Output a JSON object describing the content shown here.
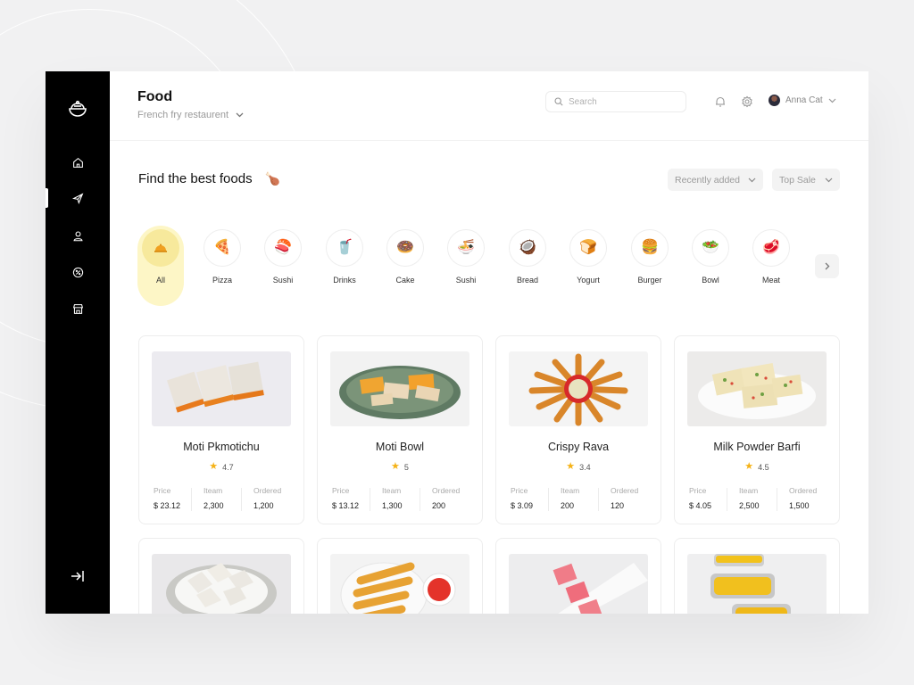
{
  "header": {
    "title": "Food",
    "subtitle": "French fry restaurent",
    "search_placeholder": "Search",
    "user_name": "Anna Cat"
  },
  "sidebar": {
    "items": [
      {
        "icon": "home-icon"
      },
      {
        "icon": "send-icon",
        "active": true
      },
      {
        "icon": "user-icon"
      },
      {
        "icon": "discount-icon"
      },
      {
        "icon": "store-icon"
      }
    ]
  },
  "section": {
    "title": "Find the best foods",
    "emoji": "🍗",
    "filters": [
      "Recently added",
      "Top Sale"
    ]
  },
  "categories": [
    {
      "label": "All",
      "icon": "🍽",
      "active": true
    },
    {
      "label": "Pizza",
      "icon": "🍕"
    },
    {
      "label": "Sushi",
      "icon": "🍣"
    },
    {
      "label": "Drinks",
      "icon": "🥤"
    },
    {
      "label": "Cake",
      "icon": "🍩"
    },
    {
      "label": "Sushi",
      "icon": "🍜"
    },
    {
      "label": "Bread",
      "icon": "🥥"
    },
    {
      "label": "Yogurt",
      "icon": "🍞"
    },
    {
      "label": "Burger",
      "icon": "🍔"
    },
    {
      "label": "Bowl",
      "icon": "🥗"
    },
    {
      "label": "Meat",
      "icon": "🥩"
    }
  ],
  "stat_labels": {
    "price": "Price",
    "item": "Iteam",
    "ordered": "Ordered"
  },
  "foods": [
    {
      "name": "Moti Pkmotichu",
      "rating": "4.7",
      "price": "$ 23.12",
      "items": "2,300",
      "ordered": "1,200"
    },
    {
      "name": "Moti Bowl",
      "rating": "5",
      "price": "$ 13.12",
      "items": "1,300",
      "ordered": "200"
    },
    {
      "name": "Crispy Rava",
      "rating": "3.4",
      "price": "$ 3.09",
      "items": "200",
      "ordered": "120"
    },
    {
      "name": "Milk Powder Barfi",
      "rating": "4.5",
      "price": "$ 4.05",
      "items": "2,500",
      "ordered": "1,500"
    }
  ],
  "colors": {
    "sidebar": "#000000",
    "accent": "#fdf6c6",
    "star": "#f5b216"
  }
}
